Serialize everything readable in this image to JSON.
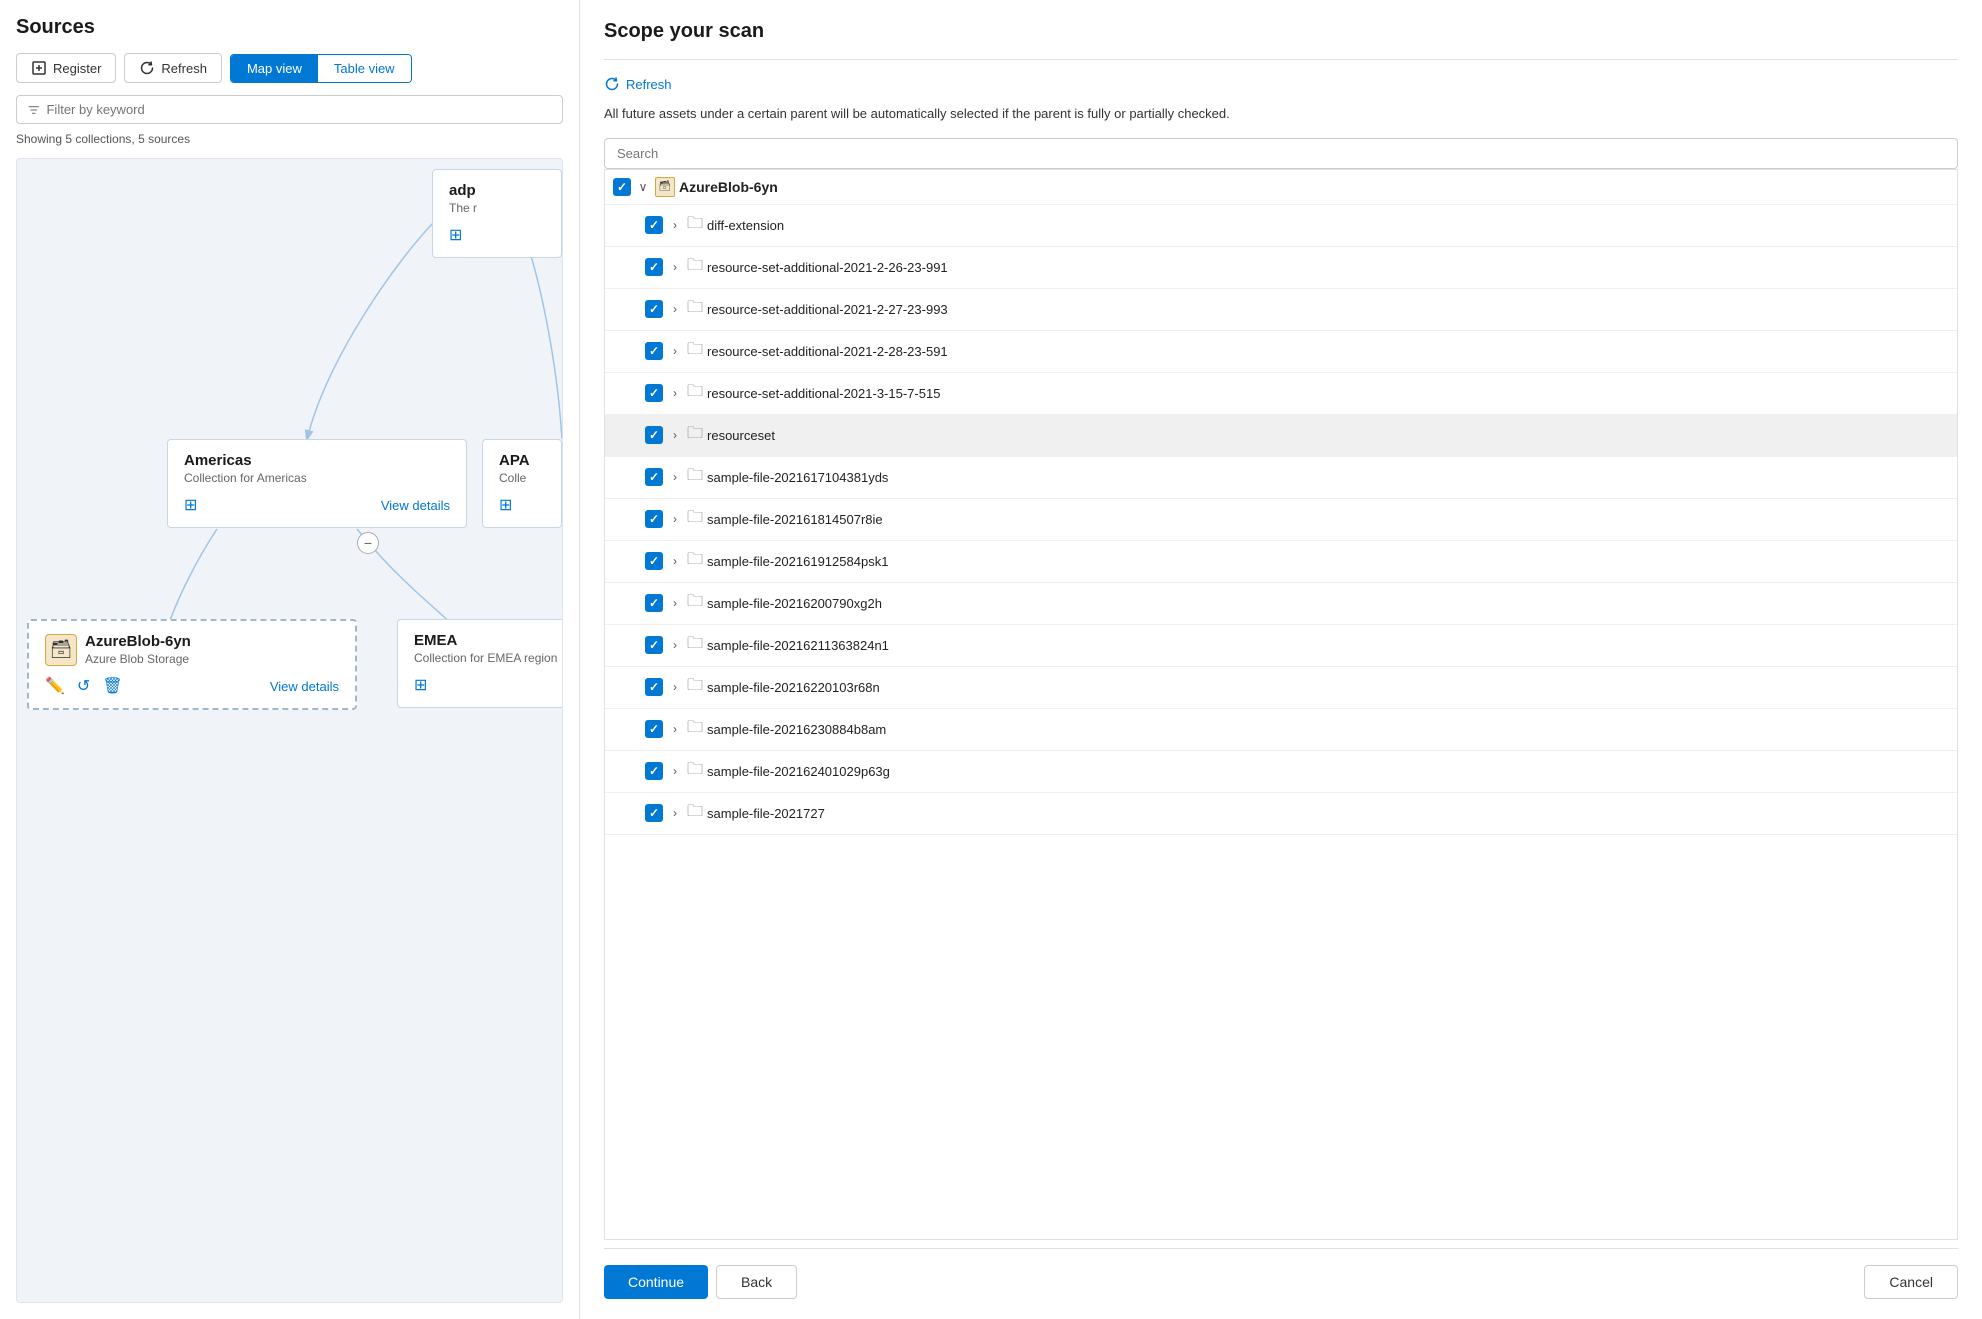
{
  "left": {
    "title": "Sources",
    "toolbar": {
      "register_label": "Register",
      "refresh_label": "Refresh",
      "map_view_label": "Map view",
      "table_view_label": "Table view"
    },
    "filter_placeholder": "Filter by keyword",
    "showing_text": "Showing 5 collections, 5 sources",
    "map": {
      "adp_node_title": "adp",
      "adp_node_subtitle": "The r",
      "americas_title": "Americas",
      "americas_subtitle": "Collection for Americas",
      "apac_title": "APA",
      "apac_subtitle": "Colle",
      "emea_title": "EMEA",
      "emea_subtitle": "Collection for EMEA region",
      "azure_blob_title": "AzureBlob-6yn",
      "azure_blob_subtitle": "Azure Blob Storage",
      "view_details_label": "View details"
    }
  },
  "right": {
    "title": "Scope your scan",
    "refresh_label": "Refresh",
    "info_text": "All future assets under a certain parent will be automatically selected if the parent is fully or partially checked.",
    "search_placeholder": "Search",
    "tree": {
      "root": {
        "label": "AzureBlob-6yn",
        "expanded": true,
        "checked": true
      },
      "items": [
        {
          "label": "diff-extension",
          "indent": 1,
          "checked": true
        },
        {
          "label": "resource-set-additional-2021-2-26-23-991",
          "indent": 1,
          "checked": true
        },
        {
          "label": "resource-set-additional-2021-2-27-23-993",
          "indent": 1,
          "checked": true
        },
        {
          "label": "resource-set-additional-2021-2-28-23-591",
          "indent": 1,
          "checked": true
        },
        {
          "label": "resource-set-additional-2021-3-15-7-515",
          "indent": 1,
          "checked": true
        },
        {
          "label": "resourceset",
          "indent": 1,
          "checked": true,
          "highlighted": true
        },
        {
          "label": "sample-file-2021617104381yds",
          "indent": 1,
          "checked": true
        },
        {
          "label": "sample-file-202161814507r8ie",
          "indent": 1,
          "checked": true
        },
        {
          "label": "sample-file-202161912584psk1",
          "indent": 1,
          "checked": true
        },
        {
          "label": "sample-file-20216200790xg2h",
          "indent": 1,
          "checked": true
        },
        {
          "label": "sample-file-20216211363824n1",
          "indent": 1,
          "checked": true
        },
        {
          "label": "sample-file-20216220103r68n",
          "indent": 1,
          "checked": true
        },
        {
          "label": "sample-file-20216230884b8am",
          "indent": 1,
          "checked": true
        },
        {
          "label": "sample-file-202162401029p63g",
          "indent": 1,
          "checked": true
        },
        {
          "label": "sample-file-2021727",
          "indent": 1,
          "checked": true
        }
      ]
    },
    "buttons": {
      "continue_label": "Continue",
      "back_label": "Back",
      "cancel_label": "Cancel"
    }
  }
}
